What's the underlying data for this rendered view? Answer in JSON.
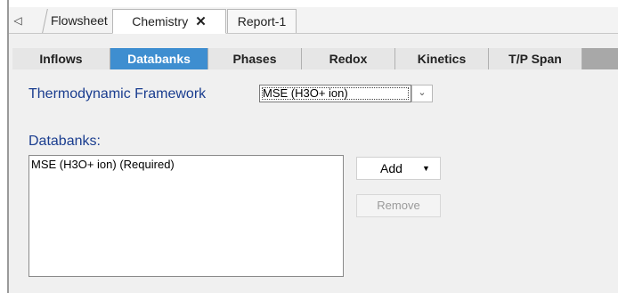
{
  "doc_tabs": [
    {
      "label": "Flowsheet"
    },
    {
      "label": "Chemistry",
      "close": "✕"
    },
    {
      "label": "Report-1"
    }
  ],
  "scroll_left_glyph": "◁",
  "sub_tabs": [
    {
      "label": "Inflows"
    },
    {
      "label": "Databanks"
    },
    {
      "label": "Phases"
    },
    {
      "label": "Redox"
    },
    {
      "label": "Kinetics"
    },
    {
      "label": "T/P Span"
    }
  ],
  "framework": {
    "label": "Thermodynamic Framework",
    "value": "MSE (H3O+ ion)",
    "dropdown_glyph": "⌄"
  },
  "databanks": {
    "label": "Databanks:",
    "items": [
      "MSE (H3O+ ion) (Required)"
    ]
  },
  "buttons": {
    "add": "Add",
    "add_arrow": "▼",
    "remove": "Remove"
  },
  "colors": {
    "active_tab": "#3e8ed0",
    "label_blue": "#1a3d8f"
  }
}
